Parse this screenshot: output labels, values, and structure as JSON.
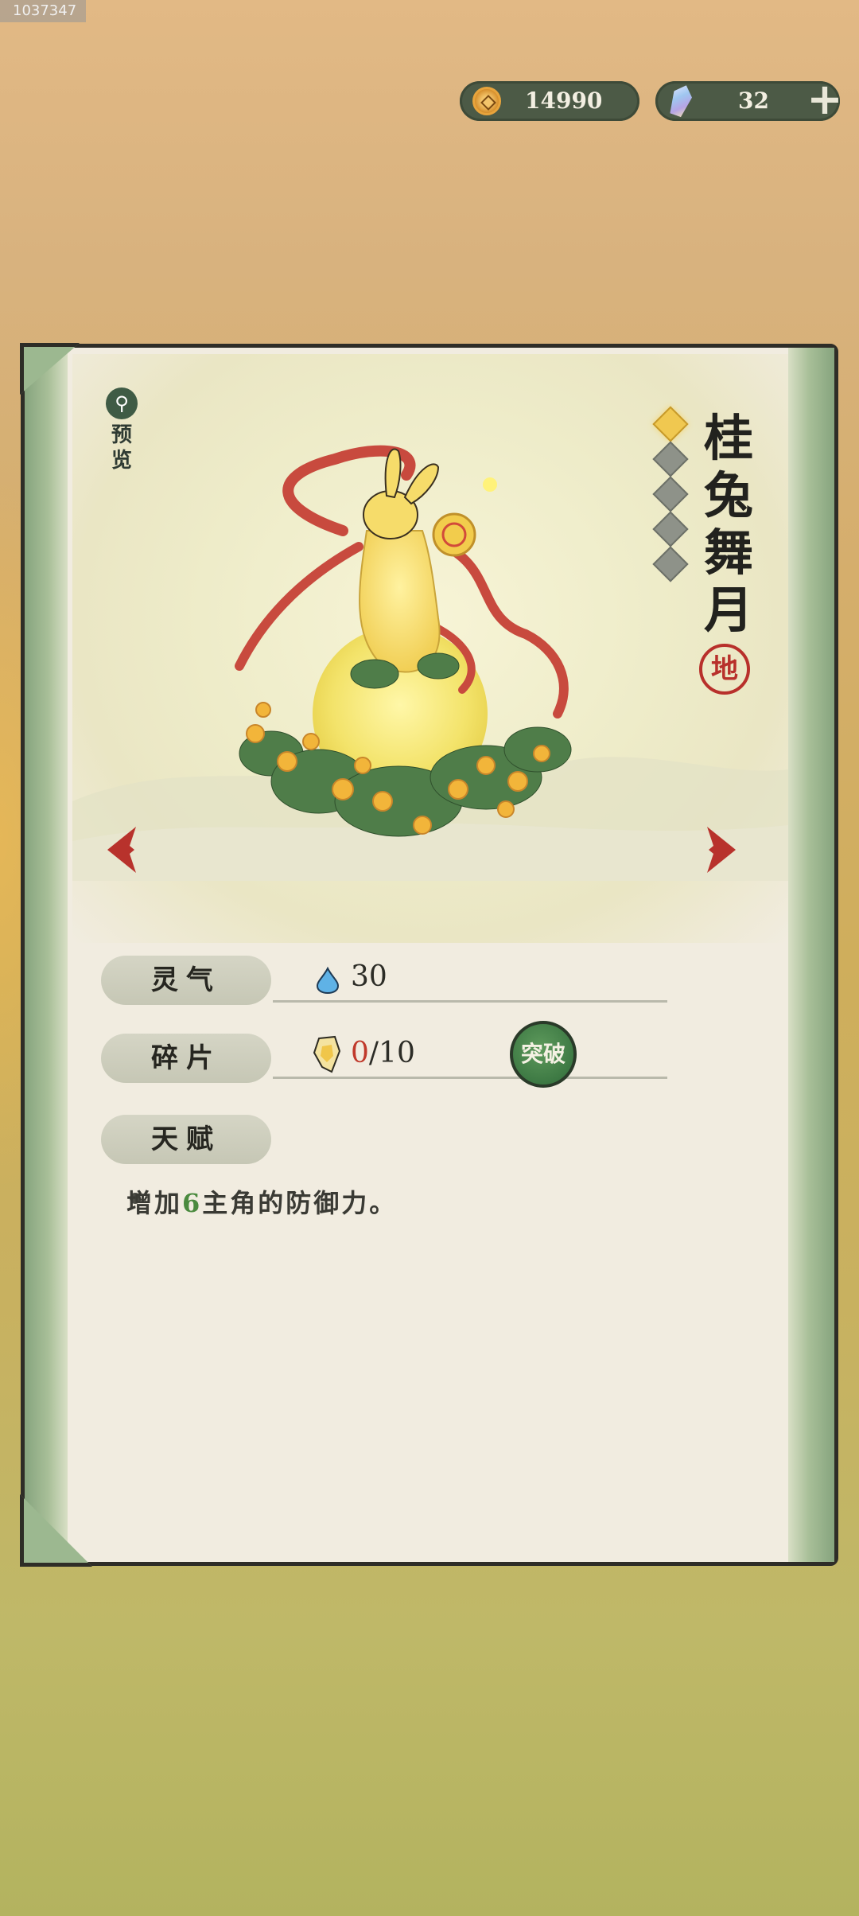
{
  "watermark_id": "1037347",
  "currency": {
    "coins": {
      "icon": "copper-coin-icon",
      "value": "14990"
    },
    "gems": {
      "icon": "spirit-crystal-icon",
      "value": "32",
      "add_label": "+"
    }
  },
  "card": {
    "preview_label": "预览",
    "name": "桂兔舞月",
    "rank_badge": "地",
    "stars_total": 5,
    "stars_lit": 1,
    "prev_arrow": "chevron-left-icon",
    "next_arrow": "chevron-right-icon"
  },
  "stats": {
    "aura": {
      "label": "灵气",
      "value": "30",
      "icon": "water-drop-icon"
    },
    "fragments": {
      "label": "碎片",
      "current": "0",
      "total": "/10",
      "icon": "shard-icon",
      "action": "突破"
    },
    "talent": {
      "label": "天赋"
    }
  },
  "talent_text": {
    "prefix": "增加",
    "number": "6",
    "suffix": "主角的防御力。"
  },
  "colors": {
    "accent_green": "#3f6e40",
    "seal_red": "#b8302b",
    "number_red": "#c0392b",
    "number_green": "#4a8a3e"
  }
}
